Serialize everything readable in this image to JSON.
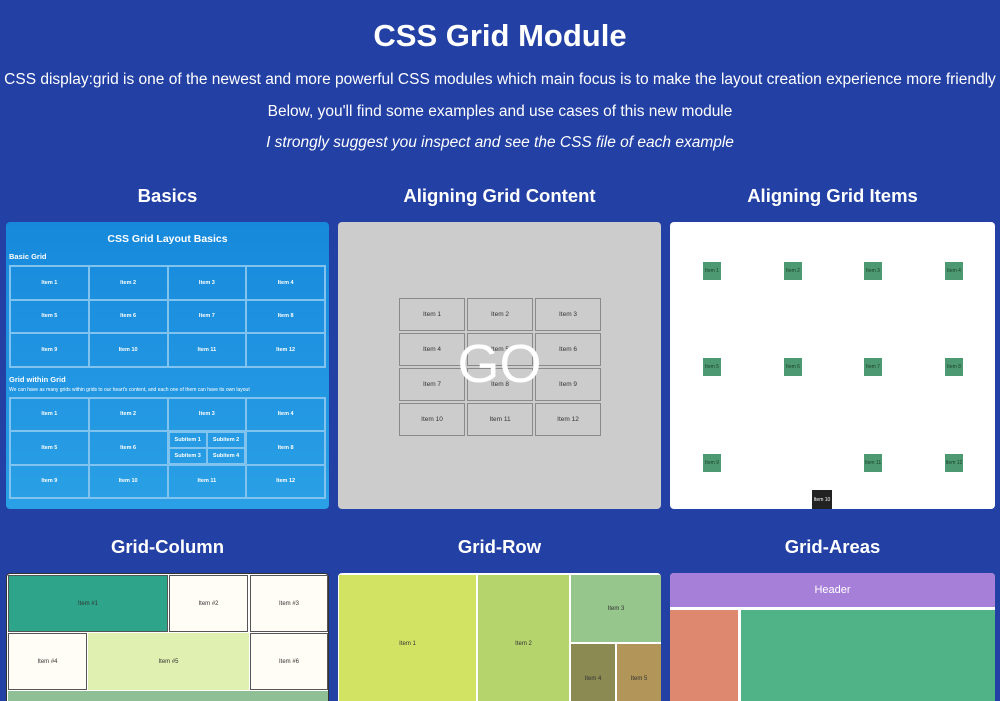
{
  "header": {
    "title": "CSS Grid Module",
    "intro": "CSS display:grid is one of the newest and more powerful CSS modules which main focus is to make the layout creation experience more friendly",
    "below": "Below, you'll find some examples and use cases of this new module",
    "suggest": "I strongly suggest you inspect and see the CSS file of each example"
  },
  "sections": {
    "basics": "Basics",
    "aligning_content": "Aligning Grid Content",
    "aligning_items": "Aligning Grid Items",
    "grid_column": "Grid-Column",
    "grid_row": "Grid-Row",
    "grid_areas": "Grid-Areas"
  },
  "basics_card": {
    "title": "CSS Grid Layout Basics",
    "basic_grid": "Basic Grid",
    "basic_items": [
      "Item 1",
      "Item 2",
      "Item 3",
      "Item 4",
      "Item 5",
      "Item 6",
      "Item 7",
      "Item 8",
      "Item 9",
      "Item 10",
      "Item 11",
      "Item 12"
    ],
    "grid_within": "Grid within Grid",
    "note": "We can have as many grids within grids to our heart's content, and each one of them can have its own layout",
    "nested_items": [
      "Item 1",
      "Item 2",
      "Item 3",
      "Item 4",
      "Item 5",
      "Item 6",
      "Item 8",
      "Item 9",
      "Item 10",
      "Item 11",
      "Item 12"
    ],
    "subitems": [
      "Subitem 1",
      "Subitem 2",
      "Subitem 3",
      "Subitem 4"
    ]
  },
  "content_card": {
    "items": [
      "Item 1",
      "Item 2",
      "Item 3",
      "Item 4",
      "Item 5",
      "Item 6",
      "Item 7",
      "Item 8",
      "Item 9",
      "Item 10",
      "Item 11",
      "Item 12"
    ],
    "overlay": "GO"
  },
  "items_card": {
    "items": [
      "Item 1",
      "Item 2",
      "Item 3",
      "Item 4",
      "Item 5",
      "Item 6",
      "Item 7",
      "Item 8",
      "Item 9",
      "Item 10",
      "Item 11",
      "Item 12"
    ],
    "color": "#4d9a72"
  },
  "column_card": {
    "items": [
      "Item #1",
      "Item #2",
      "Item #3",
      "Item #4",
      "Item #5",
      "Item #6"
    ],
    "colors": {
      "item1": "#2ea58a",
      "item5": "#e0f0b0",
      "default": "#fffdf6",
      "bottom": "#8fbf95"
    }
  },
  "row_card": {
    "items": [
      "Item 1",
      "Item 2",
      "Item 3",
      "Item 4",
      "Item 5"
    ],
    "colors": {
      "item1": "#d2e363",
      "item2": "#b5d46c",
      "item3": "#96c68c",
      "item4": "#8a8a52",
      "item5": "#b19559"
    }
  },
  "areas_card": {
    "header": "Header",
    "colors": {
      "header": "#a67fd9",
      "left": "#df8870",
      "main": "#50b287"
    }
  }
}
